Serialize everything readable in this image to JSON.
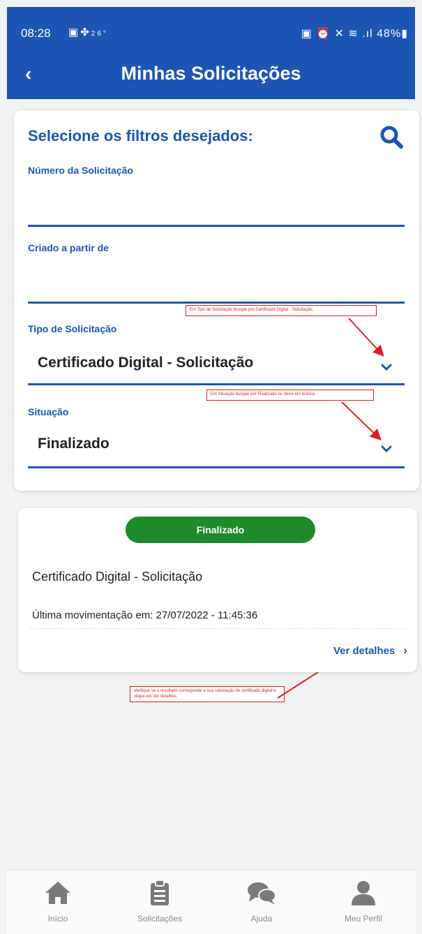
{
  "status_bar": {
    "time": "08:28",
    "temperature": "26°",
    "battery": "48%"
  },
  "header": {
    "title": "Minhas Solicitações"
  },
  "filters": {
    "heading": "Selecione os filtros desejados:",
    "numero_label": "Número da Solicitação",
    "numero_value": "",
    "criado_label": "Criado a partir de",
    "criado_value": "",
    "tipo_label": "Tipo de Solicitação",
    "tipo_value": "Certificado Digital - Solicitação",
    "situacao_label": "Situação",
    "situacao_value": "Finalizado"
  },
  "notes": {
    "tipo_note": "Em Tipo de Solicitação busque por Certificado Digital - Solicitação.",
    "situacao_note": "Em Situação busque por Finalizado ou deixe em branco.",
    "detalhes_note": "Verifique se o resultado corresponde a sua solicitação de certificado digital e clique em Ver detalhes."
  },
  "result": {
    "status": "Finalizado",
    "status_color": "#1f8a2a",
    "title": "Certificado Digital - Solicitação",
    "last_update": "Última movimentação em: 27/07/2022 - 11:45:36",
    "details_label": "Ver detalhes"
  },
  "nav": {
    "items": [
      {
        "label": "Início",
        "icon": "home-icon"
      },
      {
        "label": "Solicitações",
        "icon": "clipboard-icon"
      },
      {
        "label": "Ajuda",
        "icon": "chat-icon"
      },
      {
        "label": "Meu Perfil",
        "icon": "user-icon"
      }
    ]
  },
  "colors": {
    "primary": "#1d55b4",
    "annotation": "#e02020"
  }
}
